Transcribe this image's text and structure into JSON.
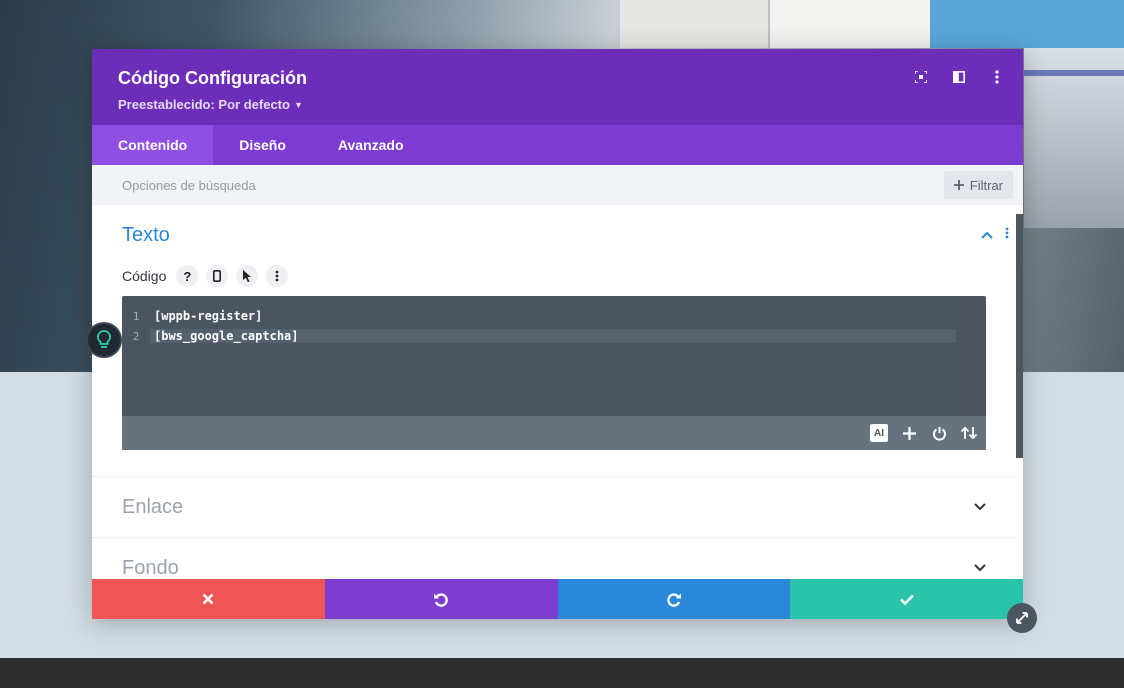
{
  "modal": {
    "title": "Código Configuración",
    "preset_label": "Preestablecido: Por defecto",
    "tabs": [
      {
        "label": "Contenido",
        "active": true
      },
      {
        "label": "Diseño",
        "active": false
      },
      {
        "label": "Avanzado",
        "active": false
      }
    ],
    "search_placeholder": "Opciones de búsqueda",
    "filter_label": "Filtrar"
  },
  "section_texto": {
    "title": "Texto",
    "field_label": "Código",
    "code_lines": [
      {
        "num": "1",
        "text": "[wppb-register]"
      },
      {
        "num": "2",
        "text": "[bws_google_captcha]"
      }
    ],
    "ai_label": "AI"
  },
  "sections_collapsed": [
    {
      "title": "Enlace"
    },
    {
      "title": "Fondo"
    }
  ],
  "colors": {
    "header": "#6c2eb9",
    "tabs": "#7d3bd2",
    "cancel": "#ef5555",
    "undo": "#7e3bd0",
    "redo": "#2b87da",
    "save": "#29c4a9",
    "section_title": "#2b87da"
  },
  "icons": [
    "fullscreen-icon",
    "split-view-icon",
    "more-vertical-icon",
    "plus-icon",
    "help-icon",
    "mobile-icon",
    "cursor-icon",
    "chevron-up-icon",
    "chevron-down-icon",
    "close-icon",
    "undo-icon",
    "redo-icon",
    "check-icon",
    "power-icon",
    "sort-icon",
    "lightbulb-icon",
    "resize-icon"
  ]
}
